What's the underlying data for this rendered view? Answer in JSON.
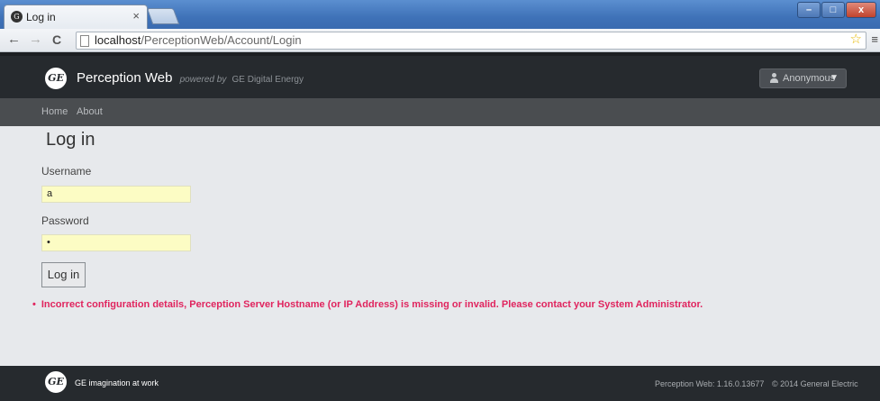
{
  "browser": {
    "tab_title": "Log in",
    "tab_close": "×",
    "url_host": "localhost",
    "url_path": "/PerceptionWeb/Account/Login",
    "back": "←",
    "forward": "→",
    "reload": "C",
    "star": "☆",
    "menu": "≡",
    "window_controls": [
      "–",
      "□",
      "x"
    ]
  },
  "header": {
    "logo_text": "GE",
    "app_name": "Perception Web",
    "powered_by": "powered by",
    "company": "GE Digital Energy",
    "user_label": "Anonymous",
    "user_chevron": "▼"
  },
  "nav": {
    "items": [
      "Home",
      "About"
    ]
  },
  "form": {
    "title": "Log in",
    "username_label": "Username",
    "username_value": "a",
    "password_label": "Password",
    "password_value": "•",
    "submit_label": "Log in",
    "error": "Incorrect configuration details, Perception Server Hostname (or IP Address) is missing or invalid. Please contact your System Administrator."
  },
  "footer": {
    "logo_text": "GE",
    "tagline": "GE imagination at work",
    "version": "Perception Web: 1.16.0.13677",
    "copyright": "© 2014 General Electric"
  }
}
